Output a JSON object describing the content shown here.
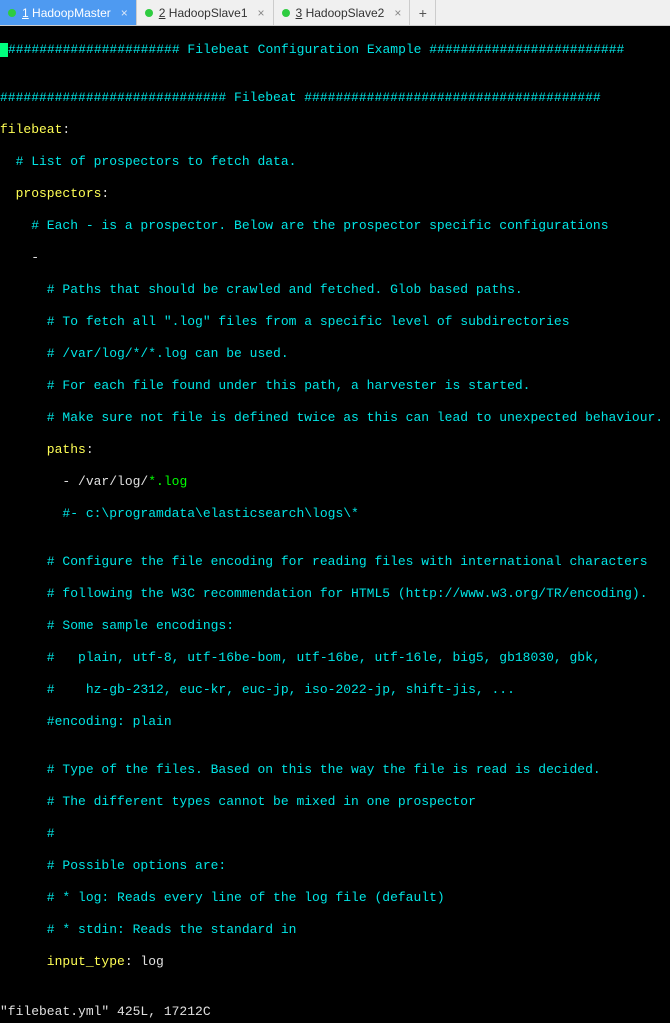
{
  "tabs": [
    {
      "num": "1",
      "label": "HadoopMaster",
      "active": true
    },
    {
      "num": "2",
      "label": "HadoopSlave1",
      "active": false
    },
    {
      "num": "3",
      "label": "HadoopSlave2",
      "active": false
    }
  ],
  "lines": {
    "l1a": "###################### Filebeat Configuration Example #########################",
    "l2": "",
    "l3": "############################# Filebeat ######################################",
    "l4a": "filebeat",
    "l4b": ":",
    "l5": "  # List of prospectors to fetch data.",
    "l6a": "  prospectors",
    "l6b": ":",
    "l7": "    # Each - is a prospector. Below are the prospector specific configurations",
    "l8": "    -",
    "l9": "      # Paths that should be crawled and fetched. Glob based paths.",
    "l10": "      # To fetch all \".log\" files from a specific level of subdirectories",
    "l11": "      # /var/log/*/*.log can be used.",
    "l12": "      # For each file found under this path, a harvester is started.",
    "l13": "      # Make sure not file is defined twice as this can lead to unexpected behaviour.",
    "l14a": "      paths",
    "l14b": ":",
    "l15a": "        - /var/log/",
    "l15b": "*.log",
    "l16": "        #- c:\\programdata\\elasticsearch\\logs\\*",
    "l17": "",
    "l18": "      # Configure the file encoding for reading files with international characters",
    "l19": "      # following the W3C recommendation for HTML5 (http://www.w3.org/TR/encoding).",
    "l20": "      # Some sample encodings:",
    "l21": "      #   plain, utf-8, utf-16be-bom, utf-16be, utf-16le, big5, gb18030, gbk,",
    "l22": "      #    hz-gb-2312, euc-kr, euc-jp, iso-2022-jp, shift-jis, ...",
    "l23": "      #encoding: plain",
    "l24": "",
    "l25": "      # Type of the files. Based on this the way the file is read is decided.",
    "l26": "      # The different types cannot be mixed in one prospector",
    "l27": "      #",
    "l28": "      # Possible options are:",
    "l29": "      # * log: Reads every line of the log file (default)",
    "l30": "      # * stdin: Reads the standard in",
    "l31a": "      input_type",
    "l31b": ": log"
  },
  "status": "\"filebeat.yml\" 425L, 17212C"
}
